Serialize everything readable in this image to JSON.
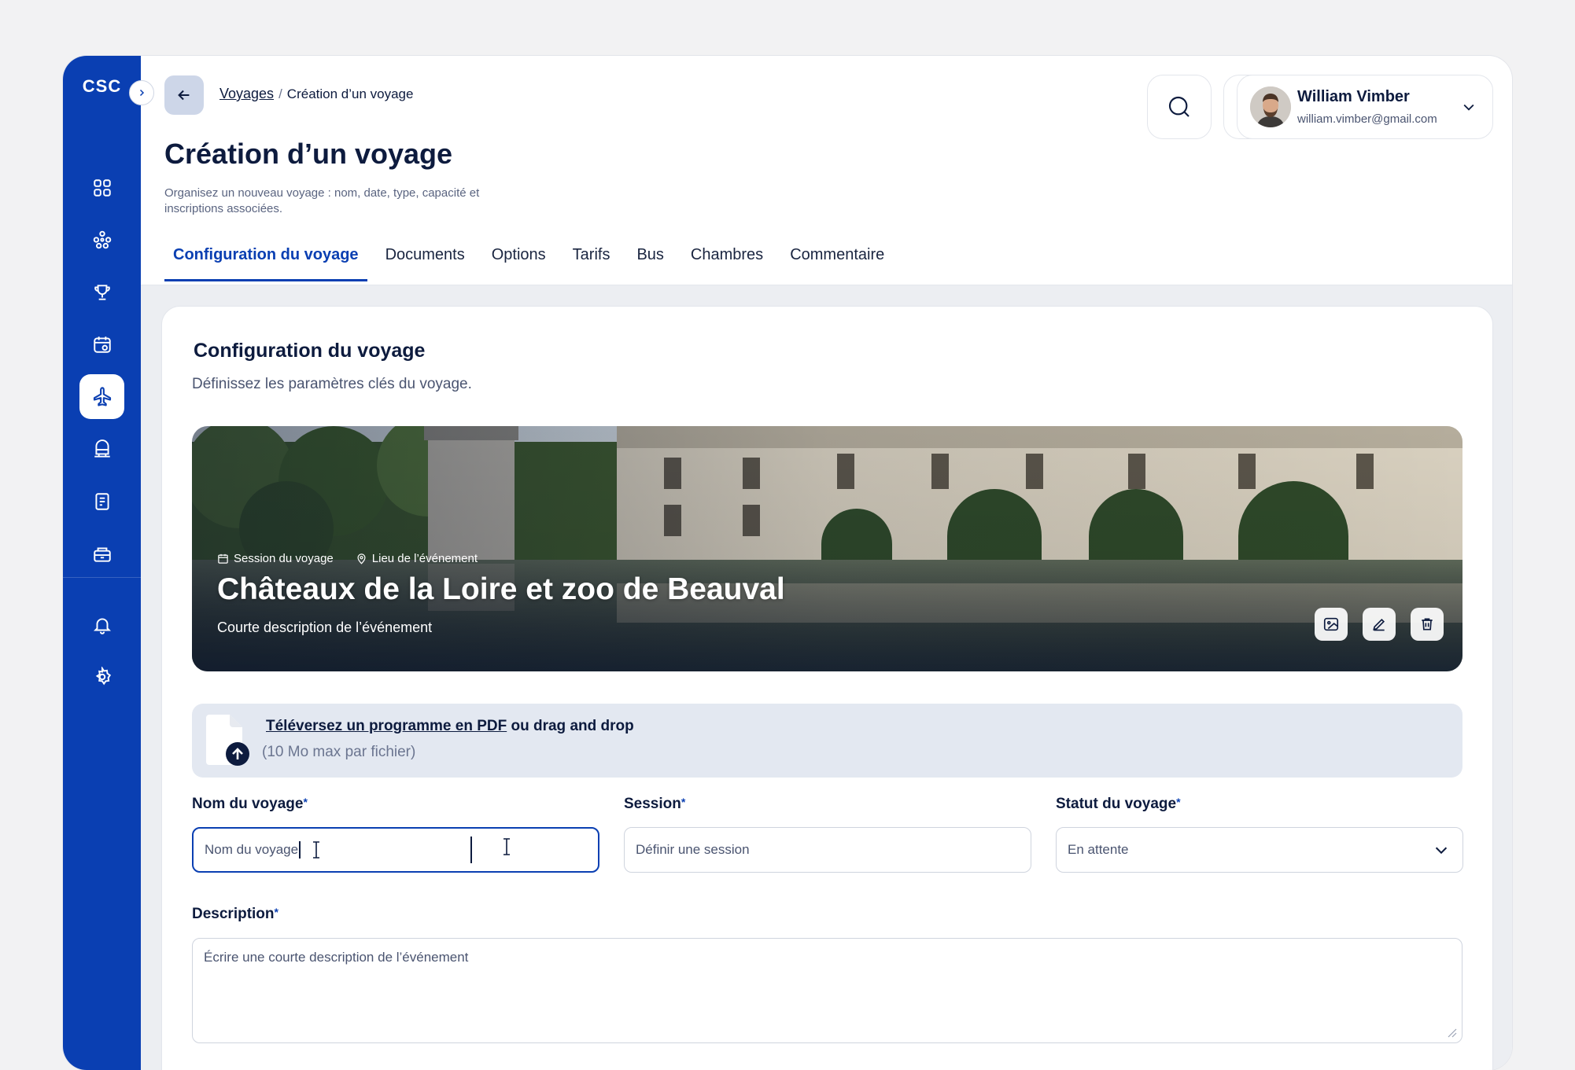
{
  "app": {
    "logo": "CSC"
  },
  "sidebar": {
    "items": [
      {
        "icon": "dashboard-icon"
      },
      {
        "icon": "network-icon"
      },
      {
        "icon": "trophy-icon"
      },
      {
        "icon": "calendar-event-icon"
      },
      {
        "icon": "plane-icon",
        "active": true
      },
      {
        "icon": "bus-icon"
      },
      {
        "icon": "document-list-icon"
      },
      {
        "icon": "reception-icon"
      }
    ],
    "bottom_items": [
      {
        "icon": "bell-icon"
      },
      {
        "icon": "settings-icon"
      }
    ]
  },
  "header": {
    "breadcrumb": {
      "parent": "Voyages",
      "separator": "/",
      "current": "Création d’un voyage"
    },
    "title": "Création d’un voyage",
    "subtitle": "Organisez un nouveau voyage  : nom, date, type, capacité et inscriptions associées."
  },
  "user": {
    "name": "William Vimber",
    "email": "william.vimber@gmail.com"
  },
  "tabs": [
    {
      "label": "Configuration du voyage",
      "active": true
    },
    {
      "label": "Documents"
    },
    {
      "label": "Options"
    },
    {
      "label": "Tarifs"
    },
    {
      "label": "Bus"
    },
    {
      "label": "Chambres"
    },
    {
      "label": "Commentaire"
    }
  ],
  "section": {
    "title": "Configuration du voyage",
    "subtitle": "Définissez les paramètres clés du voyage."
  },
  "banner": {
    "session": "Session du voyage",
    "location": "Lieu de l’événement",
    "title": "Châteaux de la Loire et zoo de Beauval",
    "description": "Courte description de l’événement"
  },
  "upload": {
    "link_text": "Téléversez un programme en PDF",
    "rest_text": " ou drag and drop",
    "hint": "(10 Mo max par fichier)"
  },
  "form": {
    "name": {
      "label": "Nom du voyage",
      "value": "Nom du voyage"
    },
    "session": {
      "label": "Session",
      "placeholder": "Définir une session"
    },
    "status": {
      "label": "Statut du voyage",
      "value": "En attente"
    },
    "description": {
      "label": "Description",
      "placeholder": "Écrire une courte description de l’événement"
    },
    "required_mark": "*"
  },
  "colors": {
    "primary": "#0a3fb2",
    "text": "#0d1b3e",
    "muted": "#4a5470"
  }
}
